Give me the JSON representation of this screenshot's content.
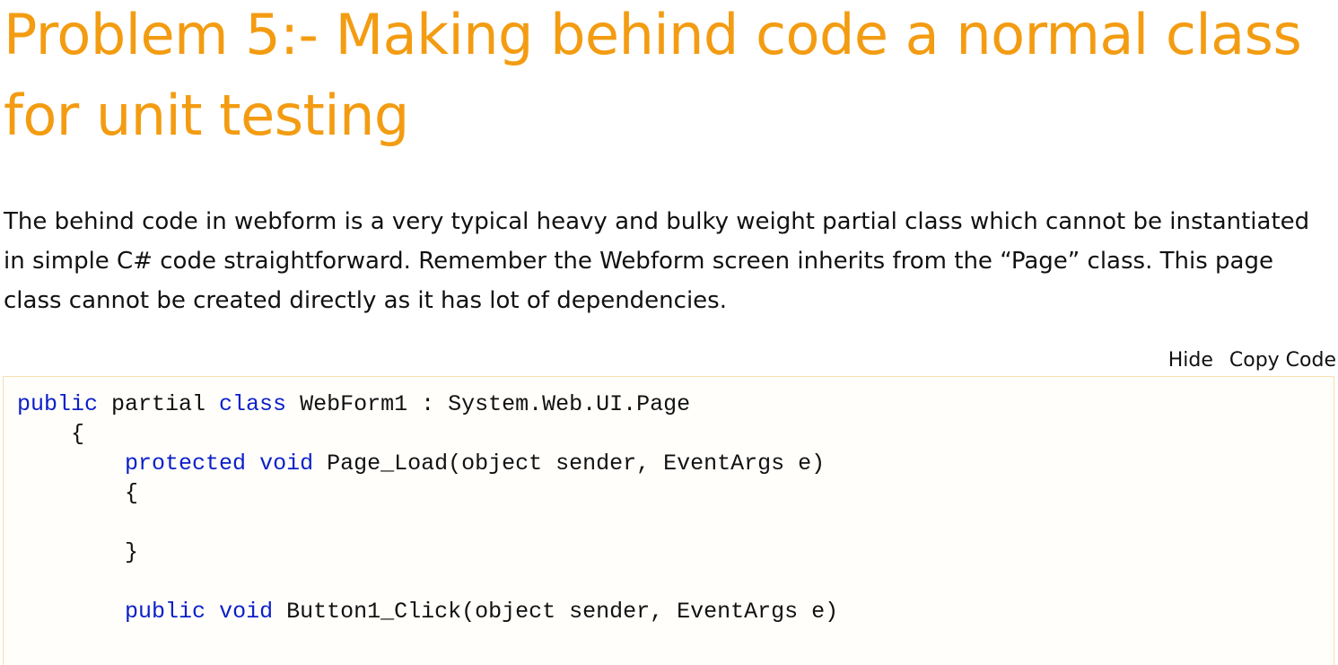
{
  "article": {
    "title": "Problem 5:- Making behind code a normal class for unit testing",
    "intro": "The behind code in webform is a very typical heavy and bulky weight partial class which cannot be instantiated in simple C# code straightforward. Remember the Webform screen inherits from the “Page” class. This page class cannot be created directly as it has lot of dependencies."
  },
  "code_block": {
    "hide_label": "Hide",
    "copy_label": "Copy Code",
    "lines": [
      [
        "public",
        " partial ",
        "class",
        " WebForm1 : System.Web.UI.Page"
      ],
      [
        "    {"
      ],
      [
        "        ",
        "protected",
        " ",
        "void",
        " Page_Load(object sender, EventArgs e)"
      ],
      [
        "        {"
      ],
      [
        ""
      ],
      [
        "        }"
      ],
      [
        ""
      ],
      [
        "        ",
        "public",
        " ",
        "void",
        " Button1_Click(object sender, EventArgs e)"
      ]
    ]
  },
  "colors": {
    "title": "#f39c12",
    "keyword": "#0b1fc9",
    "code_border": "#f7dfae",
    "text": "#111111"
  }
}
